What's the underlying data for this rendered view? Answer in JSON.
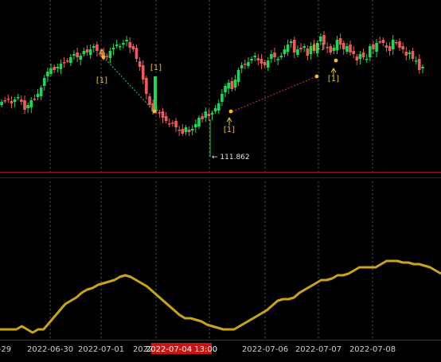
{
  "colors": {
    "background": "#000000",
    "up_candle": "#1fd655",
    "down_candle": "#ef5a5a",
    "indicator_line": "#c8a416",
    "grid": "#555555",
    "axis_text": "#d0d0d0",
    "crosshair_label_bg": "#c51616",
    "signal_marker": "#e9c21d",
    "zigzag_green": "#1fd655",
    "zigzag_red": "#d23a3a"
  },
  "time_axis": {
    "labels": [
      "-29",
      "2022-06-30",
      "2022-07-01",
      "2022-07-05",
      "2022-07-06",
      "2022-07-07",
      "2022-07-08"
    ],
    "crosshair_label": "2022-07-04 13:00"
  },
  "price_pane": {
    "low_annotation": "← 111.862",
    "signal_label": "[1]",
    "signal_count": 6
  },
  "indicator_pane": {
    "series_name": ""
  }
}
